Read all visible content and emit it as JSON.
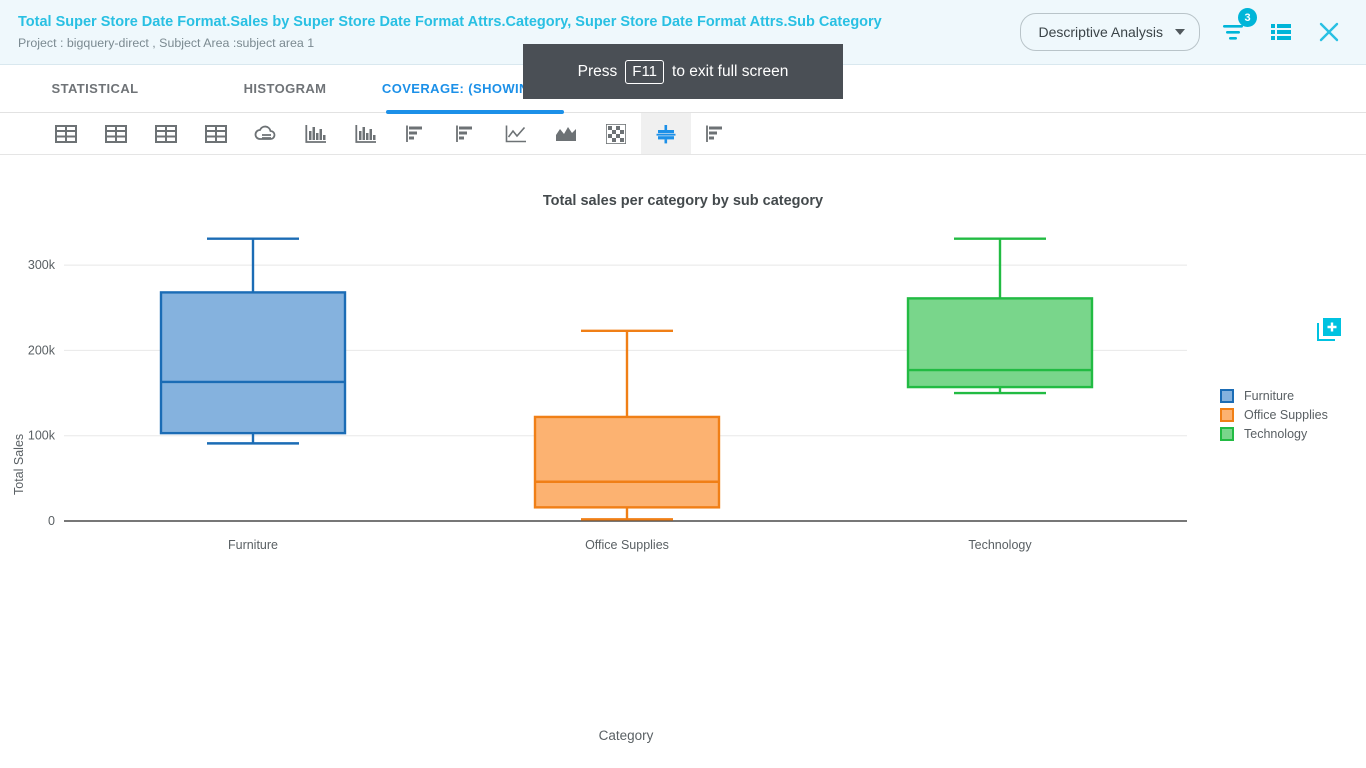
{
  "header": {
    "title": "Total Super Store Date Format.Sales by Super Store Date Format Attrs.Category, Super Store Date Format Attrs.Sub Category",
    "subtitle": "Project : bigquery-direct ,  Subject Area :subject area 1",
    "analysis_type": "Descriptive Analysis",
    "filter_badge_count": "3",
    "accent_color": "#29c0e3",
    "icons": {
      "filter": "filter-icon",
      "list": "list-icon",
      "close": "close-icon",
      "dropdown_caret": "chevron-down-icon"
    }
  },
  "fullscreen_toast": {
    "prefix": "Press",
    "key": "F11",
    "suffix": "to exit full screen"
  },
  "tabs": [
    {
      "label": "STATISTICAL",
      "active": false
    },
    {
      "label": "HISTOGRAM",
      "active": false
    },
    {
      "label": "COVERAGE: (SHOWING: 17)",
      "active": true
    }
  ],
  "toolbar": [
    {
      "name": "table-grid-1",
      "selected": false
    },
    {
      "name": "table-grid-2",
      "selected": false
    },
    {
      "name": "table-grid-3",
      "selected": false
    },
    {
      "name": "table-grid-4",
      "selected": false
    },
    {
      "name": "cloud-report",
      "selected": false
    },
    {
      "name": "bar-chart-1",
      "selected": false
    },
    {
      "name": "bar-chart-2",
      "selected": false
    },
    {
      "name": "pareto-1",
      "selected": false
    },
    {
      "name": "pareto-2",
      "selected": false
    },
    {
      "name": "line-chart",
      "selected": false
    },
    {
      "name": "area-chart",
      "selected": false
    },
    {
      "name": "heatmap",
      "selected": false
    },
    {
      "name": "box-plot",
      "selected": true
    },
    {
      "name": "pareto-3",
      "selected": false
    }
  ],
  "chart_data": {
    "type": "box",
    "title": "Total sales per category by sub category",
    "xlabel": "Category",
    "ylabel": "Total Sales",
    "categories": [
      "Furniture",
      "Office Supplies",
      "Technology"
    ],
    "ylim": [
      0,
      320000
    ],
    "yticks": [
      0,
      100000,
      200000,
      300000
    ],
    "ytick_labels": [
      "0",
      "100k",
      "200k",
      "300k"
    ],
    "grid": true,
    "legend_position": "right",
    "series": [
      {
        "name": "Furniture",
        "color": "#85b2de",
        "stroke": "#1b6cb5",
        "min": 91000,
        "q1": 103000,
        "median": 163000,
        "q3": 268000,
        "max": 331000
      },
      {
        "name": "Office Supplies",
        "color": "#fcb271",
        "stroke": "#f07f16",
        "min": 2000,
        "q1": 16000,
        "median": 46000,
        "q3": 122000,
        "max": 223000
      },
      {
        "name": "Technology",
        "color": "#79d68b",
        "stroke": "#22bb43",
        "min": 150000,
        "q1": 157000,
        "median": 177000,
        "q3": 261000,
        "max": 331000
      }
    ],
    "legend": [
      {
        "label": "Furniture",
        "fill": "#85b2de",
        "stroke": "#1b6cb5"
      },
      {
        "label": "Office Supplies",
        "fill": "#fcb271",
        "stroke": "#f07f16"
      },
      {
        "label": "Technology",
        "fill": "#79d68b",
        "stroke": "#22bb43"
      }
    ]
  },
  "add_panel": {
    "icon": "add-box-icon",
    "color": "#00c2e0"
  }
}
